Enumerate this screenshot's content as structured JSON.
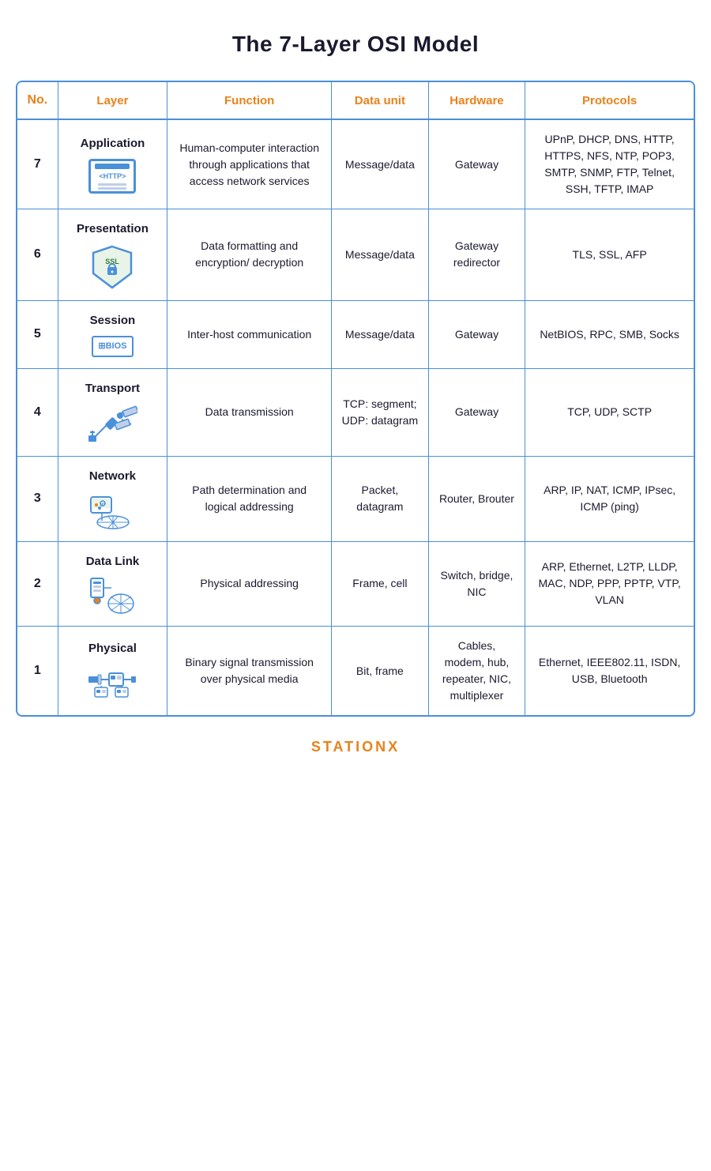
{
  "title": "The 7-Layer OSI Model",
  "table": {
    "headers": {
      "no": "No.",
      "layer": "Layer",
      "function": "Function",
      "dataunit": "Data unit",
      "hardware": "Hardware",
      "protocols": "Protocols"
    },
    "rows": [
      {
        "no": "7",
        "layer": "Application",
        "icon": "http",
        "function": "Human-computer interaction through applications that access network services",
        "dataunit": "Message/data",
        "hardware": "Gateway",
        "protocols": "UPnP, DHCP, DNS, HTTP, HTTPS, NFS, NTP, POP3, SMTP, SNMP, FTP, Telnet, SSH, TFTP, IMAP"
      },
      {
        "no": "6",
        "layer": "Presentation",
        "icon": "ssl",
        "function": "Data formatting and encryption/ decryption",
        "dataunit": "Message/data",
        "hardware": "Gateway redirector",
        "protocols": "TLS, SSL, AFP"
      },
      {
        "no": "5",
        "layer": "Session",
        "icon": "netbios",
        "function": "Inter-host communication",
        "dataunit": "Message/data",
        "hardware": "Gateway",
        "protocols": "NetBIOS, RPC, SMB, Socks"
      },
      {
        "no": "4",
        "layer": "Transport",
        "icon": "satellite",
        "function": "Data transmission",
        "dataunit": "TCP: segment; UDP: datagram",
        "hardware": "Gateway",
        "protocols": "TCP, UDP, SCTP"
      },
      {
        "no": "3",
        "layer": "Network",
        "icon": "network",
        "function": "Path determination and logical addressing",
        "dataunit": "Packet, datagram",
        "hardware": "Router, Brouter",
        "protocols": "ARP, IP, NAT, ICMP, IPsec, ICMP (ping)"
      },
      {
        "no": "2",
        "layer": "Data Link",
        "icon": "datalink",
        "function": "Physical addressing",
        "dataunit": "Frame, cell",
        "hardware": "Switch, bridge, NIC",
        "protocols": "ARP, Ethernet, L2TP, LLDP, MAC, NDP, PPP, PPTP, VTP, VLAN"
      },
      {
        "no": "1",
        "layer": "Physical",
        "icon": "physical",
        "function": "Binary signal transmission over physical media",
        "dataunit": "Bit, frame",
        "hardware": "Cables, modem, hub, repeater, NIC, multiplexer",
        "protocols": "Ethernet, IEEE802.11, ISDN, USB, Bluetooth"
      }
    ]
  },
  "footer": {
    "brand_part1": "STATION",
    "brand_part2": "X"
  }
}
